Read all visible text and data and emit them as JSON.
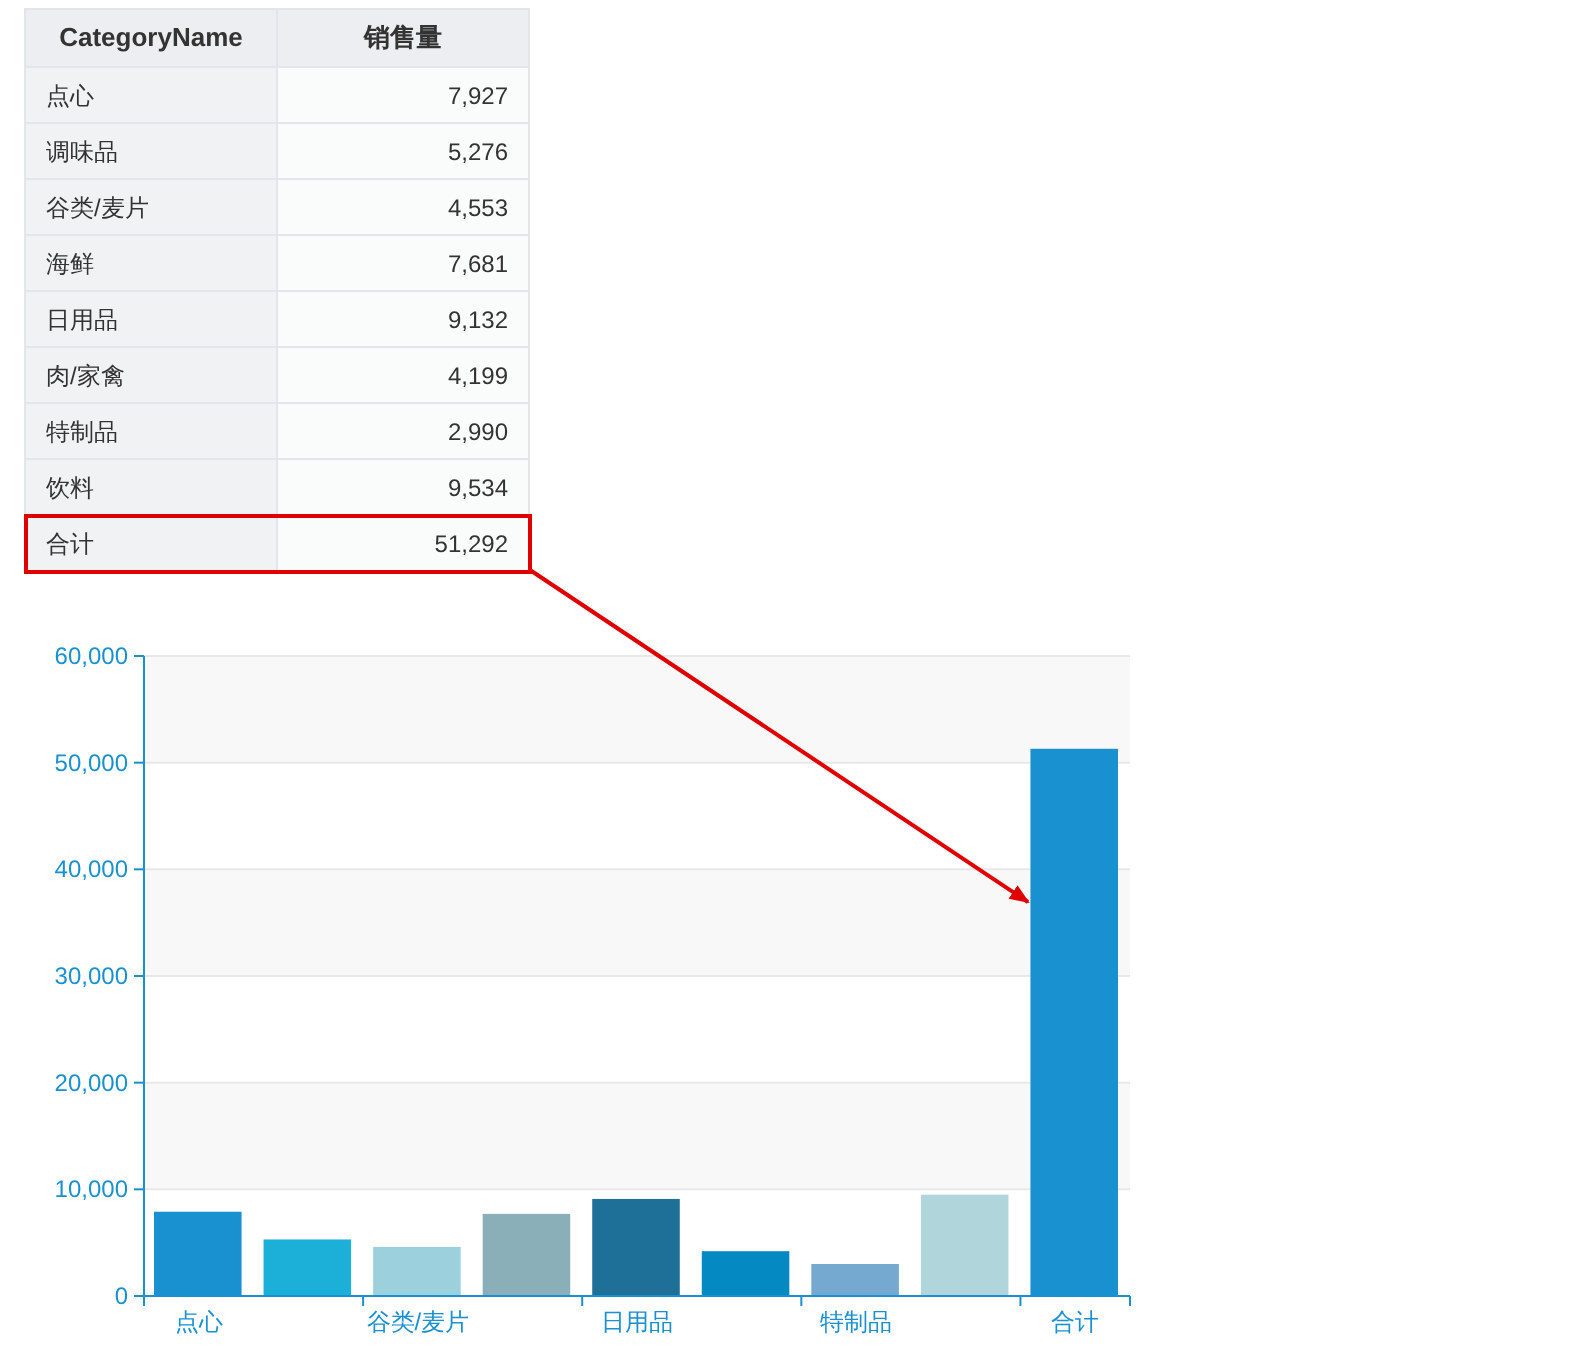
{
  "table": {
    "columns": [
      "CategoryName",
      "销售量"
    ],
    "rows": [
      {
        "name": "点心",
        "value": "7,927",
        "highlighted": false
      },
      {
        "name": "调味品",
        "value": "5,276",
        "highlighted": false
      },
      {
        "name": "谷类/麦片",
        "value": "4,553",
        "highlighted": false
      },
      {
        "name": "海鲜",
        "value": "7,681",
        "highlighted": false
      },
      {
        "name": "日用品",
        "value": "9,132",
        "highlighted": false
      },
      {
        "name": "肉/家禽",
        "value": "4,199",
        "highlighted": false
      },
      {
        "name": "特制品",
        "value": "2,990",
        "highlighted": false
      },
      {
        "name": "饮料",
        "value": "9,534",
        "highlighted": false
      },
      {
        "name": "合计",
        "value": "51,292",
        "highlighted": true
      }
    ]
  },
  "chart": {
    "chart_data": {
      "type": "bar",
      "ylim": [
        0,
        60000
      ],
      "yticks": [
        {
          "value": 0,
          "label": "0"
        },
        {
          "value": 10000,
          "label": "10,000"
        },
        {
          "value": 20000,
          "label": "20,000"
        },
        {
          "value": 30000,
          "label": "30,000"
        },
        {
          "value": 40000,
          "label": "40,000"
        },
        {
          "value": 50000,
          "label": "50,000"
        },
        {
          "value": 60000,
          "label": "60,000"
        }
      ],
      "grid": true,
      "categories": [
        "点心",
        null,
        "谷类/麦片",
        null,
        "日用品",
        null,
        "特制品",
        null,
        "合计"
      ],
      "values": [
        7900,
        5300,
        4600,
        7700,
        9100,
        4200,
        3000,
        9500,
        51300
      ],
      "colors": [
        "#1990d0",
        "#1cb0d8",
        "#9bd0dc",
        "#8aafb8",
        "#1f7099",
        "#0589c2",
        "#76a9cf",
        "#b0d6dc",
        "#1990d0"
      ]
    }
  }
}
